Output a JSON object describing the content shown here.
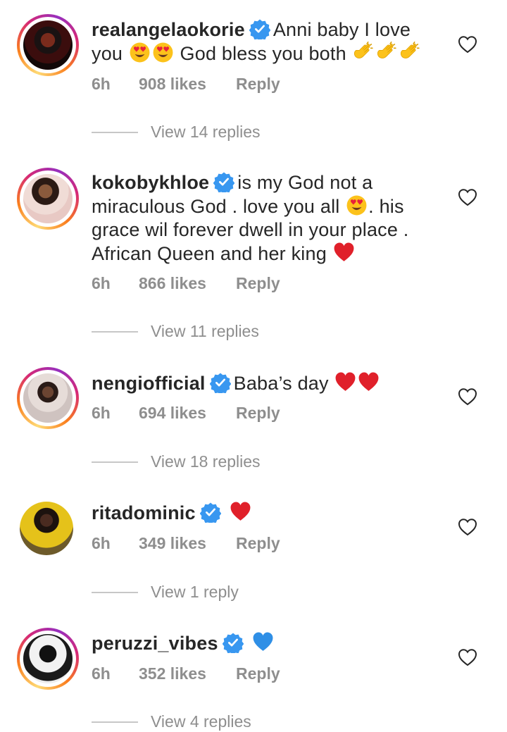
{
  "comments": [
    {
      "username": "realangelaokorie",
      "text_line1": "Anni baby I love",
      "text_line2_a": "you",
      "text_line2_b": "God bless you both",
      "time": "6h",
      "likes": "908 likes",
      "reply": "Reply",
      "view_replies": "View 14 replies"
    },
    {
      "username": "kokobykhloe",
      "text_line1": "is my God not a",
      "text_line2_a": "miraculous God . love you all",
      "text_line2_b": ". his",
      "text_line3": "grace wil forever dwell in your place .",
      "text_line4": "African Queen and her king",
      "time": "6h",
      "likes": "866 likes",
      "reply": "Reply",
      "view_replies": "View 11 replies"
    },
    {
      "username": "nengiofficial",
      "text": "Baba’s day",
      "time": "6h",
      "likes": "694 likes",
      "reply": "Reply",
      "view_replies": "View 18 replies"
    },
    {
      "username": "ritadominic",
      "text": "",
      "time": "6h",
      "likes": "349 likes",
      "reply": "Reply",
      "view_replies": "View 1 reply"
    },
    {
      "username": "peruzzi_vibes",
      "text": "",
      "time": "6h",
      "likes": "352 likes",
      "reply": "Reply",
      "view_replies": "View 4 replies"
    }
  ],
  "colors": {
    "verified": "#3897f0",
    "meta_gray": "#8e8e8e",
    "red_heart": "#e0202a",
    "blue_heart": "#2f8fe6"
  },
  "icons": [
    "verified-badge-icon",
    "heart-eyes-emoji",
    "clapping-hands-emoji",
    "red-heart-emoji",
    "blue-heart-emoji",
    "heart-outline-icon"
  ]
}
